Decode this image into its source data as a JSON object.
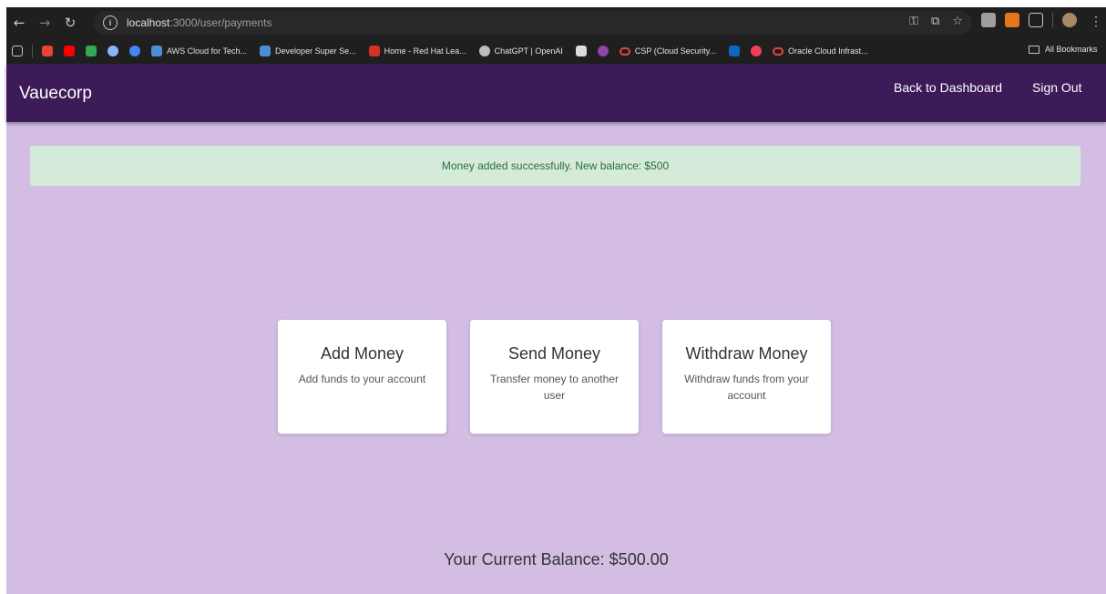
{
  "browser": {
    "url_host": "localhost",
    "url_path": ":3000/user/payments",
    "bookmarks": [
      {
        "label": "AWS Cloud for Tech...",
        "color": "#4a8fd6"
      },
      {
        "label": "Developer Super Se...",
        "color": "#4a8fd6"
      },
      {
        "label": "Home - Red Hat Lea...",
        "color": "#d93025"
      },
      {
        "label": "ChatGPT | OpenAI",
        "color": "#bdbdbd"
      },
      {
        "label": "CSP (Cloud Security...",
        "color": "#e8453c"
      },
      {
        "label": "Oracle Cloud Infrast...",
        "color": "#e8453c"
      }
    ],
    "all_bookmarks": "All Bookmarks"
  },
  "app": {
    "brand": "Vauecorp",
    "nav": {
      "dashboard": "Back to Dashboard",
      "signout": "Sign Out"
    },
    "alert": "Money added successfully. New balance: $500",
    "cards": [
      {
        "title": "Add Money",
        "desc": "Add funds to your account"
      },
      {
        "title": "Send Money",
        "desc": "Transfer money to another user"
      },
      {
        "title": "Withdraw Money",
        "desc": "Withdraw funds from your account"
      }
    ],
    "balance": "Your Current Balance: $500.00"
  },
  "colors": {
    "navbar": "#3d1a58",
    "background": "#d3bde3",
    "alert_bg": "#d4ebd9",
    "alert_text": "#2e6b3f"
  }
}
